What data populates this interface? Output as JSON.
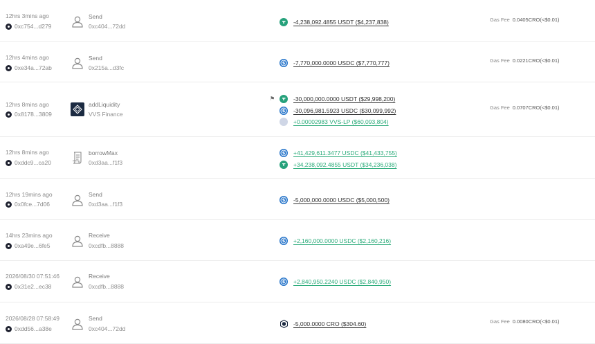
{
  "gas_label": "Gas Fee",
  "transactions": [
    {
      "time": "12hrs 3mins ago",
      "hash": "0xc754...d279",
      "action": "Send",
      "action_icon": "user-icon",
      "counterparty": "0xc404...72dd",
      "tokens": [
        {
          "icon": "usdt",
          "amount": "-4,238,092.4855 USDT ($4,237,838)",
          "direction": "out"
        }
      ],
      "gas_fee": "0.0405CRO(<$0.01)"
    },
    {
      "time": "12hrs 4mins ago",
      "hash": "0xe34a...72ab",
      "action": "Send",
      "action_icon": "user-icon",
      "counterparty": "0x215a...d3fc",
      "tokens": [
        {
          "icon": "usdc",
          "amount": "-7,770,000.0000 USDC ($7,770,777)",
          "direction": "out"
        }
      ],
      "gas_fee": "0.0221CRO(<$0.01)"
    },
    {
      "time": "12hrs 8mins ago",
      "hash": "0x8178...3809",
      "action": "addLiquidity",
      "action_icon": "vvs-finance-logo",
      "counterparty": "VVS Finance",
      "tokens": [
        {
          "icon": "usdt",
          "amount": "-30,000,000.0000 USDT ($29,998,200)",
          "direction": "out"
        },
        {
          "icon": "usdc",
          "amount": "-30,096,981.5923 USDC ($30,099,992)",
          "direction": "out"
        },
        {
          "icon": "lp",
          "amount": "+0.00002983 VVS-LP ($60,093,804)",
          "direction": "in"
        }
      ],
      "gas_fee": "0.0707CRO(<$0.01)",
      "flagged": true
    },
    {
      "time": "12hrs 8mins ago",
      "hash": "0xddc9...ca20",
      "action": "borrowMax",
      "action_icon": "contract-icon",
      "counterparty": "0xd3aa...f1f3",
      "tokens": [
        {
          "icon": "usdc",
          "amount": "+41,429,611.3477 USDC ($41,433,755)",
          "direction": "in"
        },
        {
          "icon": "usdt",
          "amount": "+34,238,092.4855 USDT ($34,236,038)",
          "direction": "in"
        }
      ],
      "gas_fee": ""
    },
    {
      "time": "12hrs 19mins ago",
      "hash": "0x0fce...7d06",
      "action": "Send",
      "action_icon": "user-icon",
      "counterparty": "0xd3aa...f1f3",
      "tokens": [
        {
          "icon": "usdc",
          "amount": "-5,000,000.0000 USDC ($5,000,500)",
          "direction": "out"
        }
      ],
      "gas_fee": ""
    },
    {
      "time": "14hrs 23mins ago",
      "hash": "0xa49e...6fe5",
      "action": "Receive",
      "action_icon": "user-icon",
      "counterparty": "0xcdfb...8888",
      "tokens": [
        {
          "icon": "usdc",
          "amount": "+2,160,000.0000 USDC ($2,160,216)",
          "direction": "in"
        }
      ],
      "gas_fee": ""
    },
    {
      "time": "2026/08/30 07:51:46",
      "hash": "0x31e2...ec38",
      "action": "Receive",
      "action_icon": "user-icon",
      "counterparty": "0xcdfb...8888",
      "tokens": [
        {
          "icon": "usdc",
          "amount": "+2,840,950.2240 USDC ($2,840,950)",
          "direction": "in"
        }
      ],
      "gas_fee": ""
    },
    {
      "time": "2026/08/28 07:58:49",
      "hash": "0xdd56...a38e",
      "action": "Send",
      "action_icon": "user-icon",
      "counterparty": "0xc404...72dd",
      "tokens": [
        {
          "icon": "cro",
          "amount": "-5,000.0000 CRO ($304.60)",
          "direction": "out"
        }
      ],
      "gas_fee": "0.0080CRO(<$0.01)"
    }
  ]
}
